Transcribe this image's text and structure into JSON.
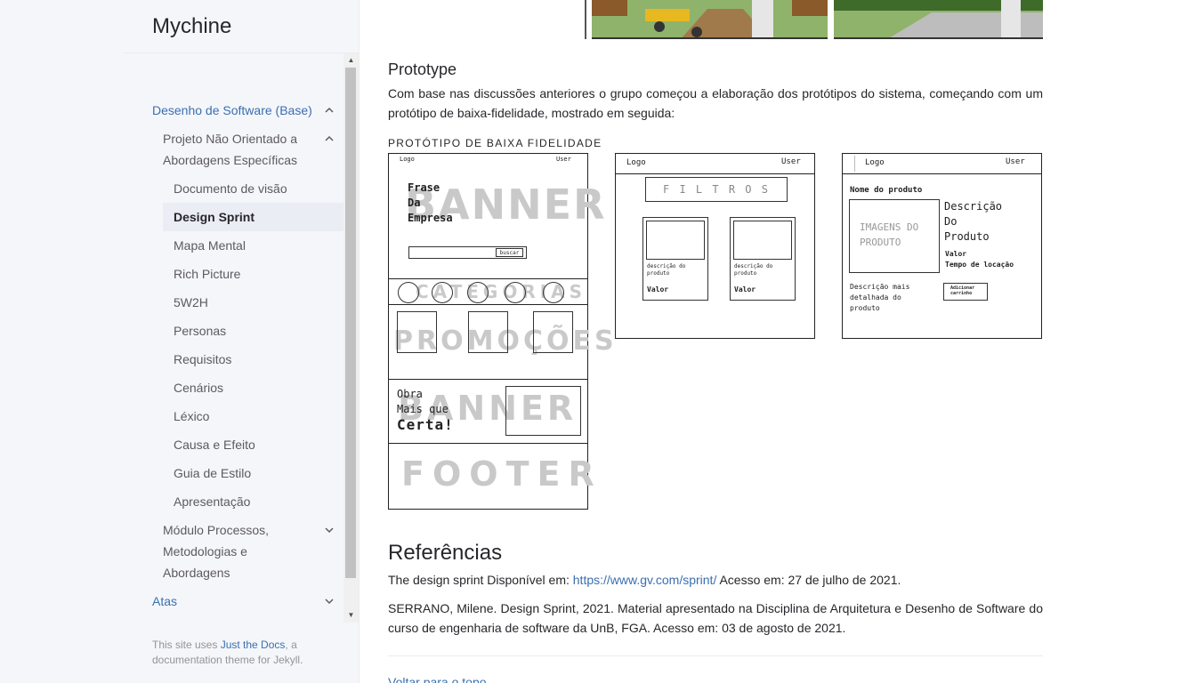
{
  "site": {
    "title": "Mychine"
  },
  "nav": {
    "section1": "Desenho de Software (Base)",
    "sub1": "Projeto Não Orientado a Abordagens Específicas",
    "items": [
      "Documento de visão",
      "Design Sprint",
      "Mapa Mental",
      "Rich Picture",
      "5W2H",
      "Personas",
      "Requisitos",
      "Cenários",
      "Léxico",
      "Causa e Efeito",
      "Guia de Estilo",
      "Apresentação"
    ],
    "sub2": "Módulo Processos, Metodologias e Abordagens",
    "section2": "Atas"
  },
  "footer": {
    "prefix": "This site uses ",
    "link": "Just the Docs",
    "suffix": ", a documentation theme for Jekyll."
  },
  "content": {
    "prototype_heading": "Prototype",
    "prototype_text": "Com base nas discussões anteriores o grupo começou a elaboração dos protótipos do sistema, começando com um protótipo de baixa-fidelidade, mostrado em seguida:",
    "figure_caption": "PROTÓTIPO DE BAIXA FIDELIDADE",
    "references_heading": "Referências",
    "ref1_prefix": "The design sprint Disponível em: ",
    "ref1_link": "https://www.gv.com/sprint/",
    "ref1_suffix": " Acesso em: 27 de julho de 2021.",
    "ref2": "SERRANO, Milene. Design Sprint, 2021. Material apresentado na Disciplina de Arquitetura e Desenho de Software do curso de engenharia de software da UnB, FGA. Acesso em: 03 de agosto de 2021.",
    "back_to_top": "Voltar para o topo"
  },
  "sketches": {
    "home": {
      "logo": "Logo",
      "user": "User",
      "banner_bg": "BANNER",
      "slogan": [
        "Frase",
        "Da",
        "Empresa"
      ],
      "search_btn": "buscar",
      "categories_bg": "CATEGORIAS",
      "promos_bg": "PROMOÇÕES",
      "banner2_bg": "BANNER",
      "banner2_text": [
        "Obra",
        "Mais que",
        "Certa!"
      ],
      "footer_bg": "FOOTER"
    },
    "list": {
      "logo": "Logo",
      "user": "User",
      "filters": "F I L T R O S",
      "product_desc": "descrição do produto",
      "product_value": "Valor"
    },
    "detail": {
      "logo": "Logo",
      "user": "User",
      "product_name": "Nome do produto",
      "images": "IMAGENS DO PRODUTO",
      "description": [
        "Descrição",
        "Do",
        "Produto"
      ],
      "value": "Valor",
      "rental_time": "Tempo de locação",
      "long_desc": "Descrição mais detalhada do produto",
      "cart_btn": "Adicionar carrinho"
    }
  }
}
